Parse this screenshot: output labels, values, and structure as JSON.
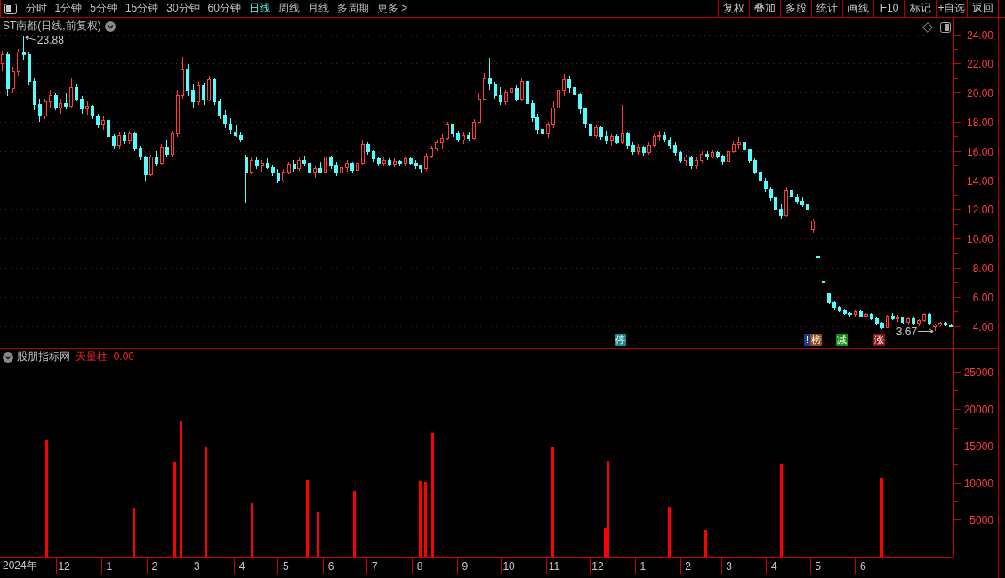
{
  "toolbar": {
    "periods": [
      {
        "label": "分时",
        "selected": false
      },
      {
        "label": "1分钟",
        "selected": false
      },
      {
        "label": "5分钟",
        "selected": false
      },
      {
        "label": "15分钟",
        "selected": false
      },
      {
        "label": "30分钟",
        "selected": false
      },
      {
        "label": "60分钟",
        "selected": false
      },
      {
        "label": "日线",
        "selected": true
      },
      {
        "label": "周线",
        "selected": false
      },
      {
        "label": "月线",
        "selected": false
      },
      {
        "label": "多周期",
        "selected": false
      },
      {
        "label": "更多 >",
        "selected": false
      }
    ],
    "actions": [
      "复权",
      "叠加",
      "多股",
      "统计",
      "画线",
      "F10",
      "标记",
      "+自选",
      "返回"
    ]
  },
  "price_pane": {
    "title": "ST南都(日线,前复权)",
    "events": [
      {
        "label": "停",
        "color": "#148c8c"
      },
      {
        "label": "!",
        "color": "#1e3c8c"
      },
      {
        "label": "榜",
        "color": "#8c4a14"
      },
      {
        "label": "减",
        "color": "#148c14"
      },
      {
        "label": "涨",
        "color": "#8c1414"
      }
    ],
    "chart_data": [
      {
        "type": "candlestick",
        "ylim": [
          2.54,
          25.16
        ],
        "yticks": [
          {
            "value": 4,
            "label": "4.00"
          },
          {
            "value": 6,
            "label": "6.00"
          },
          {
            "value": 8,
            "label": "8.00"
          },
          {
            "value": 10,
            "label": "10.00"
          },
          {
            "value": 12,
            "label": "12.00"
          },
          {
            "value": 14,
            "label": "14.00"
          },
          {
            "value": 16,
            "label": "16.00"
          },
          {
            "value": 18,
            "label": "18.00"
          },
          {
            "value": 20,
            "label": "20.00"
          },
          {
            "value": 22,
            "label": "22.00"
          },
          {
            "value": 24,
            "label": "24.00"
          }
        ],
        "grid": true,
        "annotations": [
          "23.88",
          "3.67"
        ],
        "ohlc": [
          [
            22.0,
            22.9,
            21.5,
            22.6
          ],
          [
            22.6,
            22.8,
            19.8,
            20.3
          ],
          [
            20.3,
            21.8,
            20.0,
            21.5
          ],
          [
            21.5,
            23.0,
            21.2,
            22.8
          ],
          [
            22.8,
            23.88,
            22.3,
            22.6
          ],
          [
            22.6,
            22.8,
            20.5,
            20.8
          ],
          [
            20.8,
            21.0,
            18.8,
            19.2
          ],
          [
            19.2,
            19.6,
            18.0,
            18.4
          ],
          [
            18.4,
            19.6,
            18.2,
            19.4
          ],
          [
            19.4,
            20.2,
            19.0,
            19.8
          ],
          [
            19.8,
            20.0,
            18.8,
            19.0
          ],
          [
            19.0,
            19.6,
            18.6,
            19.3
          ],
          [
            19.3,
            20.0,
            18.9,
            19.1
          ],
          [
            19.1,
            21.0,
            19.0,
            20.4
          ],
          [
            20.4,
            20.6,
            19.4,
            19.6
          ],
          [
            19.6,
            19.8,
            18.6,
            18.9
          ],
          [
            18.9,
            19.4,
            18.5,
            19.1
          ],
          [
            19.1,
            19.2,
            18.2,
            18.4
          ],
          [
            18.4,
            18.6,
            17.6,
            17.8
          ],
          [
            17.8,
            18.4,
            17.5,
            18.1
          ],
          [
            18.1,
            18.2,
            16.8,
            17.0
          ],
          [
            17.0,
            17.2,
            16.2,
            16.4
          ],
          [
            16.4,
            17.3,
            16.2,
            17.1
          ],
          [
            17.1,
            17.3,
            16.5,
            16.7
          ],
          [
            16.7,
            17.4,
            16.5,
            17.2
          ],
          [
            17.2,
            17.3,
            16.0,
            16.2
          ],
          [
            16.2,
            16.4,
            15.4,
            15.6
          ],
          [
            15.6,
            15.7,
            14.0,
            14.4
          ],
          [
            14.4,
            15.8,
            14.3,
            15.6
          ],
          [
            15.6,
            16.0,
            15.0,
            15.2
          ],
          [
            15.2,
            16.5,
            15.1,
            16.3
          ],
          [
            16.3,
            16.8,
            15.6,
            15.8
          ],
          [
            15.8,
            17.4,
            15.6,
            17.2
          ],
          [
            17.2,
            20.2,
            17.0,
            19.8
          ],
          [
            19.8,
            22.5,
            19.6,
            21.6
          ],
          [
            21.6,
            22.0,
            19.8,
            20.2
          ],
          [
            20.2,
            20.6,
            19.0,
            19.4
          ],
          [
            19.4,
            20.8,
            19.2,
            20.5
          ],
          [
            20.5,
            20.7,
            19.2,
            19.5
          ],
          [
            19.5,
            21.2,
            19.4,
            20.9
          ],
          [
            20.9,
            21.0,
            19.2,
            19.4
          ],
          [
            19.4,
            19.6,
            18.2,
            18.5
          ],
          [
            18.5,
            18.8,
            17.6,
            17.9
          ],
          [
            17.9,
            18.3,
            17.2,
            17.5
          ],
          [
            17.3,
            17.8,
            17.0,
            17.1
          ],
          [
            17.1,
            17.3,
            16.6,
            16.8
          ],
          [
            15.6,
            15.8,
            12.5,
            14.6
          ],
          [
            14.6,
            15.6,
            14.4,
            15.4
          ],
          [
            15.4,
            15.6,
            14.8,
            15.0
          ],
          [
            15.0,
            15.4,
            14.6,
            15.2
          ],
          [
            15.2,
            15.5,
            14.8,
            14.9
          ],
          [
            14.9,
            15.1,
            14.3,
            14.5
          ],
          [
            14.5,
            14.8,
            13.8,
            14.0
          ],
          [
            14.0,
            14.8,
            13.9,
            14.6
          ],
          [
            14.6,
            15.3,
            14.4,
            15.1
          ],
          [
            15.1,
            15.4,
            14.6,
            14.8
          ],
          [
            14.8,
            15.6,
            14.7,
            15.4
          ],
          [
            15.4,
            15.7,
            15.0,
            15.2
          ],
          [
            15.2,
            15.4,
            14.4,
            14.6
          ],
          [
            14.6,
            15.0,
            14.2,
            14.8
          ],
          [
            14.8,
            15.3,
            14.5,
            14.6
          ],
          [
            14.6,
            15.9,
            14.5,
            15.6
          ],
          [
            15.6,
            15.7,
            14.8,
            15.0
          ],
          [
            15.0,
            15.3,
            14.3,
            14.5
          ],
          [
            14.5,
            15.1,
            14.3,
            14.9
          ],
          [
            14.9,
            15.4,
            14.6,
            15.2
          ],
          [
            15.2,
            15.3,
            14.5,
            14.7
          ],
          [
            14.7,
            15.4,
            14.5,
            15.2
          ],
          [
            15.2,
            16.8,
            15.1,
            16.5
          ],
          [
            16.5,
            16.6,
            15.8,
            16.0
          ],
          [
            16.0,
            16.1,
            15.3,
            15.5
          ],
          [
            15.5,
            15.6,
            15.0,
            15.2
          ],
          [
            15.2,
            15.6,
            15.0,
            15.4
          ],
          [
            15.4,
            15.5,
            15.0,
            15.1
          ],
          [
            15.1,
            15.5,
            14.9,
            15.3
          ],
          [
            15.3,
            15.4,
            15.0,
            15.2
          ],
          [
            15.2,
            15.6,
            15.0,
            15.5
          ],
          [
            15.5,
            15.6,
            15.1,
            15.2
          ],
          [
            15.2,
            15.4,
            14.8,
            15.0
          ],
          [
            15.0,
            15.1,
            14.5,
            14.8
          ],
          [
            14.8,
            15.9,
            14.7,
            15.7
          ],
          [
            15.7,
            16.4,
            15.5,
            16.2
          ],
          [
            16.2,
            16.8,
            16.0,
            16.6
          ],
          [
            16.6,
            17.2,
            16.2,
            16.9
          ],
          [
            16.9,
            18.0,
            16.8,
            17.8
          ],
          [
            17.8,
            17.9,
            17.0,
            17.2
          ],
          [
            17.2,
            17.4,
            16.6,
            16.8
          ],
          [
            16.8,
            17.3,
            16.5,
            17.1
          ],
          [
            17.1,
            17.3,
            16.7,
            16.9
          ],
          [
            16.9,
            18.2,
            16.8,
            18.0
          ],
          [
            18.0,
            20.0,
            17.9,
            19.6
          ],
          [
            19.6,
            21.4,
            19.5,
            21.0
          ],
          [
            21.0,
            22.4,
            20.2,
            20.6
          ],
          [
            20.6,
            20.8,
            19.6,
            19.8
          ],
          [
            19.8,
            20.4,
            19.2,
            19.4
          ],
          [
            19.4,
            20.2,
            19.2,
            20.0
          ],
          [
            20.0,
            20.6,
            19.6,
            20.3
          ],
          [
            20.3,
            20.5,
            19.4,
            19.6
          ],
          [
            19.6,
            21.0,
            19.4,
            20.8
          ],
          [
            20.8,
            21.0,
            19.0,
            19.3
          ],
          [
            19.3,
            19.5,
            18.0,
            18.3
          ],
          [
            18.3,
            18.6,
            17.2,
            17.5
          ],
          [
            17.5,
            17.8,
            16.8,
            17.2
          ],
          [
            17.2,
            18.0,
            16.9,
            17.8
          ],
          [
            17.8,
            19.4,
            17.6,
            19.0
          ],
          [
            19.0,
            20.6,
            18.8,
            20.2
          ],
          [
            20.2,
            21.3,
            19.8,
            20.9
          ],
          [
            20.9,
            21.2,
            20.0,
            20.4
          ],
          [
            20.4,
            21.0,
            19.6,
            19.9
          ],
          [
            19.9,
            20.0,
            18.6,
            18.9
          ],
          [
            18.9,
            19.0,
            17.6,
            17.9
          ],
          [
            17.9,
            18.0,
            16.8,
            17.1
          ],
          [
            17.1,
            17.8,
            16.9,
            17.6
          ],
          [
            17.6,
            17.7,
            16.8,
            17.0
          ],
          [
            17.0,
            17.4,
            16.5,
            16.7
          ],
          [
            16.7,
            17.2,
            16.4,
            17.0
          ],
          [
            17.0,
            17.2,
            16.5,
            16.6
          ],
          [
            16.6,
            19.2,
            16.5,
            17.2
          ],
          [
            17.2,
            17.3,
            16.2,
            16.4
          ],
          [
            16.4,
            16.6,
            15.8,
            16.0
          ],
          [
            16.0,
            16.5,
            15.8,
            16.3
          ],
          [
            16.3,
            16.4,
            15.7,
            15.9
          ],
          [
            15.9,
            16.6,
            15.8,
            16.4
          ],
          [
            16.4,
            17.2,
            16.3,
            17.0
          ],
          [
            17.0,
            17.4,
            16.7,
            17.1
          ],
          [
            17.1,
            17.3,
            16.6,
            16.8
          ],
          [
            16.8,
            17.0,
            16.2,
            16.4
          ],
          [
            16.4,
            16.6,
            15.7,
            15.9
          ],
          [
            15.9,
            16.0,
            15.2,
            15.4
          ],
          [
            15.4,
            15.8,
            15.0,
            15.6
          ],
          [
            15.6,
            15.7,
            14.8,
            15.0
          ],
          [
            15.0,
            15.6,
            14.8,
            15.4
          ],
          [
            15.4,
            16.0,
            15.2,
            15.8
          ],
          [
            15.8,
            16.0,
            15.4,
            15.6
          ],
          [
            15.6,
            16.1,
            15.5,
            15.9
          ],
          [
            15.9,
            16.0,
            15.5,
            15.7
          ],
          [
            15.7,
            15.8,
            15.1,
            15.3
          ],
          [
            15.3,
            16.2,
            15.2,
            16.0
          ],
          [
            16.0,
            16.7,
            15.9,
            16.5
          ],
          [
            16.5,
            17.0,
            16.2,
            16.6
          ],
          [
            16.6,
            16.7,
            15.9,
            16.1
          ],
          [
            16.1,
            16.2,
            15.2,
            15.4
          ],
          [
            15.4,
            15.5,
            14.4,
            14.6
          ],
          [
            14.6,
            14.8,
            13.8,
            14.0
          ],
          [
            14.0,
            14.2,
            13.2,
            13.4
          ],
          [
            13.4,
            13.6,
            12.6,
            12.8
          ],
          [
            12.8,
            13.0,
            11.8,
            12.0
          ],
          [
            12.0,
            12.4,
            11.4,
            11.6
          ],
          [
            11.6,
            13.6,
            11.5,
            13.3
          ],
          [
            13.3,
            13.4,
            12.6,
            12.9
          ],
          [
            12.9,
            13.1,
            12.4,
            12.6
          ],
          [
            12.6,
            12.9,
            12.2,
            12.4
          ],
          [
            12.4,
            12.6,
            11.8,
            12.0
          ],
          [
            10.6,
            11.4,
            10.4,
            11.2
          ],
          [
            8.8,
            8.8,
            8.8,
            8.8
          ],
          [
            7.1,
            7.1,
            7.1,
            7.1
          ],
          [
            6.2,
            6.3,
            5.5,
            5.6
          ],
          [
            5.6,
            5.7,
            5.1,
            5.3
          ],
          [
            5.3,
            5.4,
            5.0,
            5.1
          ],
          [
            5.1,
            5.2,
            4.8,
            4.9
          ],
          [
            4.9,
            5.0,
            4.6,
            4.8
          ],
          [
            4.8,
            5.1,
            4.7,
            5.0
          ],
          [
            5.0,
            5.1,
            4.6,
            4.7
          ],
          [
            4.7,
            4.9,
            4.6,
            4.8
          ],
          [
            4.8,
            4.9,
            4.4,
            4.5
          ],
          [
            4.5,
            4.6,
            4.1,
            4.2
          ],
          [
            4.2,
            4.3,
            3.8,
            3.9
          ],
          [
            3.9,
            4.8,
            3.9,
            4.7
          ],
          [
            4.7,
            4.9,
            4.4,
            4.5
          ],
          [
            4.5,
            4.8,
            4.3,
            4.6
          ],
          [
            4.6,
            4.7,
            4.2,
            4.3
          ],
          [
            4.3,
            4.6,
            4.1,
            4.5
          ],
          [
            4.5,
            4.6,
            4.1,
            4.2
          ],
          [
            4.2,
            4.5,
            4.0,
            4.4
          ],
          [
            4.4,
            4.9,
            4.3,
            4.8
          ],
          [
            4.8,
            4.9,
            4.1,
            4.2
          ],
          [
            4.0,
            4.2,
            3.67,
            4.1
          ],
          [
            4.1,
            4.3,
            4.0,
            4.2
          ],
          [
            4.2,
            4.3,
            4.0,
            4.1
          ],
          [
            4.1,
            4.2,
            3.95,
            4.0
          ]
        ]
      }
    ]
  },
  "indicator_pane": {
    "source": "股朋指标网",
    "legend": "天量柱: 0.00",
    "year_label": "2024年",
    "chart_data": [
      {
        "type": "bar",
        "x": [
          "2023-11-23",
          "2024-01-22",
          "2024-02-19",
          "2024-02-23",
          "2024-03-11",
          "2024-04-12",
          "2024-05-20",
          "2024-05-27",
          "2024-06-21",
          "2024-08-05",
          "2024-08-09",
          "2024-08-14",
          "2024-11-04",
          "2024-12-10",
          "2024-12-12",
          "2025-01-23",
          "2025-02-17",
          "2025-04-10",
          "2025-06-18"
        ],
        "values": [
          15800,
          6600,
          12800,
          18500,
          14900,
          7200,
          10400,
          6000,
          8900,
          10300,
          10100,
          16800,
          14900,
          3900,
          13000,
          6800,
          3600,
          12500,
          10700
        ],
        "color": "#ff0000",
        "xlim": [
          "2023-10-22",
          "2025-08-06"
        ],
        "xticks": [
          {
            "value": "2023-12-05",
            "label": "12"
          },
          {
            "value": "2024-01-05",
            "label": "1"
          },
          {
            "value": "2024-02-05",
            "label": "2"
          },
          {
            "value": "2024-03-05",
            "label": "3"
          },
          {
            "value": "2024-04-05",
            "label": "4"
          },
          {
            "value": "2024-05-05",
            "label": "5"
          },
          {
            "value": "2024-06-05",
            "label": "6"
          },
          {
            "value": "2024-07-05",
            "label": "7"
          },
          {
            "value": "2024-08-05",
            "label": "8"
          },
          {
            "value": "2024-09-05",
            "label": "9"
          },
          {
            "value": "2024-10-05",
            "label": "10"
          },
          {
            "value": "2024-11-05",
            "label": "11"
          },
          {
            "value": "2024-12-05",
            "label": "12"
          },
          {
            "value": "2025-01-05",
            "label": "1"
          },
          {
            "value": "2025-02-05",
            "label": "2"
          },
          {
            "value": "2025-03-05",
            "label": "3"
          },
          {
            "value": "2025-04-05",
            "label": "4"
          },
          {
            "value": "2025-05-05",
            "label": "5"
          },
          {
            "value": "2025-06-05",
            "label": "6"
          }
        ],
        "ylim": [
          0,
          28250
        ],
        "yticks": [
          5000,
          10000,
          15000,
          20000,
          25000
        ]
      }
    ]
  }
}
